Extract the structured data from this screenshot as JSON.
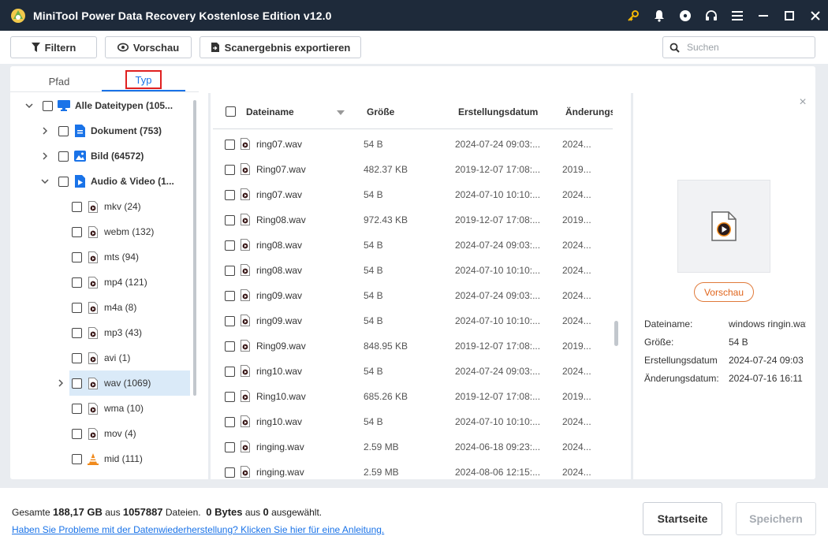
{
  "window": {
    "title": "MiniTool Power Data Recovery Kostenlose Edition v12.0"
  },
  "toolbar": {
    "filter_label": "Filtern",
    "preview_label": "Vorschau",
    "export_label": "Scanergebnis exportieren",
    "search_placeholder": "Suchen"
  },
  "tabs": {
    "path": "Pfad",
    "type": "Typ"
  },
  "tree": {
    "all": "Alle Dateitypen (105...",
    "document": "Dokument (753)",
    "image": "Bild (64572)",
    "audio_video": "Audio & Video (1...",
    "items": [
      "mkv (24)",
      "webm (132)",
      "mts (94)",
      "mp4 (121)",
      "m4a (8)",
      "mp3 (43)",
      "avi (1)",
      "wav (1069)",
      "wma (10)",
      "mov (4)",
      "mid (111)"
    ]
  },
  "columns": {
    "name": "Dateiname",
    "size": "Größe",
    "created": "Erstellungsdatum",
    "modified": "Änderungs"
  },
  "files": [
    {
      "name": "ring07.wav",
      "size": "54 B",
      "created": "2024-07-24 09:03:...",
      "modified": "2024..."
    },
    {
      "name": "Ring07.wav",
      "size": "482.37 KB",
      "created": "2019-12-07 17:08:...",
      "modified": "2019..."
    },
    {
      "name": "ring07.wav",
      "size": "54 B",
      "created": "2024-07-10 10:10:...",
      "modified": "2024..."
    },
    {
      "name": "Ring08.wav",
      "size": "972.43 KB",
      "created": "2019-12-07 17:08:...",
      "modified": "2019..."
    },
    {
      "name": "ring08.wav",
      "size": "54 B",
      "created": "2024-07-24 09:03:...",
      "modified": "2024..."
    },
    {
      "name": "ring08.wav",
      "size": "54 B",
      "created": "2024-07-10 10:10:...",
      "modified": "2024..."
    },
    {
      "name": "ring09.wav",
      "size": "54 B",
      "created": "2024-07-24 09:03:...",
      "modified": "2024..."
    },
    {
      "name": "ring09.wav",
      "size": "54 B",
      "created": "2024-07-10 10:10:...",
      "modified": "2024..."
    },
    {
      "name": "Ring09.wav",
      "size": "848.95 KB",
      "created": "2019-12-07 17:08:...",
      "modified": "2019..."
    },
    {
      "name": "ring10.wav",
      "size": "54 B",
      "created": "2024-07-24 09:03:...",
      "modified": "2024..."
    },
    {
      "name": "Ring10.wav",
      "size": "685.26 KB",
      "created": "2019-12-07 17:08:...",
      "modified": "2019..."
    },
    {
      "name": "ring10.wav",
      "size": "54 B",
      "created": "2024-07-10 10:10:...",
      "modified": "2024..."
    },
    {
      "name": "ringing.wav",
      "size": "2.59 MB",
      "created": "2024-06-18 09:23:...",
      "modified": "2024..."
    },
    {
      "name": "ringing.wav",
      "size": "2.59 MB",
      "created": "2024-08-06 12:15:...",
      "modified": "2024..."
    }
  ],
  "preview": {
    "button": "Vorschau",
    "labels": {
      "name": "Dateiname:",
      "size": "Größe:",
      "created": "Erstellungsdatum",
      "modified": "Änderungsdatum:"
    },
    "values": {
      "name": "windows ringin.wav",
      "size": "54 B",
      "created": "2024-07-24 09:03",
      "modified": "2024-07-16 16:11"
    }
  },
  "footer": {
    "total_prefix": "Gesamte ",
    "total_size": "188,17 GB",
    "total_mid": " aus ",
    "total_files": "1057887",
    "total_suffix": " Dateien.",
    "sel_size": "0 Bytes",
    "sel_mid": " aus ",
    "sel_count": "0",
    "sel_suffix": " ausgewählt.",
    "help_link": "Haben Sie Probleme mit der Datenwiederherstellung? Klicken Sie hier für eine Anleitung.",
    "home_button": "Startseite",
    "save_button": "Speichern"
  },
  "colors": {
    "titlebar": "#1e2a3a",
    "accent": "#1a73e8",
    "preview_button": "#e0651c",
    "frame": "#e9ecf0",
    "selected_row": "#daeaf8"
  }
}
